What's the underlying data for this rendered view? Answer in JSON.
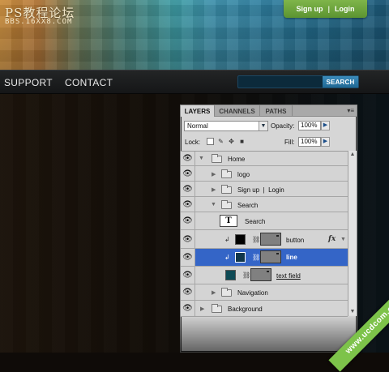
{
  "header": {
    "logo_title": "PS教程论坛",
    "logo_subtitle": "BBS.16XX8.COM",
    "signup_label": "Sign up",
    "separator": "|",
    "login_label": "Login"
  },
  "nav": {
    "items": [
      "SUPPORT",
      "CONTACT"
    ],
    "search_placeholder": "",
    "search_button": "SEARCH"
  },
  "layers_panel": {
    "tabs": [
      "LAYERS",
      "CHANNELS",
      "PATHS"
    ],
    "active_tab": "LAYERS",
    "menu_icon": "panel-menu-icon",
    "blend_mode": "Normal",
    "opacity_label": "Opacity:",
    "opacity_value": "100%",
    "lock_label": "Lock:",
    "fill_label": "Fill:",
    "fill_value": "100%",
    "layers": [
      {
        "name": "Home",
        "type": "group",
        "indent": 0,
        "expanded": true
      },
      {
        "name": "logo",
        "type": "group",
        "indent": 1,
        "expanded": false
      },
      {
        "name": "Sign up  |  Login",
        "type": "group",
        "indent": 1,
        "expanded": false
      },
      {
        "name": "Search",
        "type": "group",
        "indent": 1,
        "expanded": true
      },
      {
        "name": "Search",
        "type": "text",
        "indent": 2,
        "thumb": "T"
      },
      {
        "name": "button",
        "type": "shape",
        "indent": 2,
        "swatch": "#000000",
        "fx": "fx"
      },
      {
        "name": "line",
        "type": "shape",
        "indent": 2,
        "swatch": "#10364a",
        "selected": true
      },
      {
        "name": "text field",
        "type": "shape",
        "indent": 2,
        "swatch": "#0e4a55"
      },
      {
        "name": "Navigation",
        "type": "group",
        "indent": 1,
        "expanded": false
      },
      {
        "name": "Background",
        "type": "group",
        "indent": 0,
        "expanded": false
      }
    ]
  },
  "watermark": "www.ucdcom.com",
  "colors": {
    "accent_green": "#6aa63c",
    "search_blue": "#2a78a8",
    "selection_blue": "#3465c7"
  }
}
